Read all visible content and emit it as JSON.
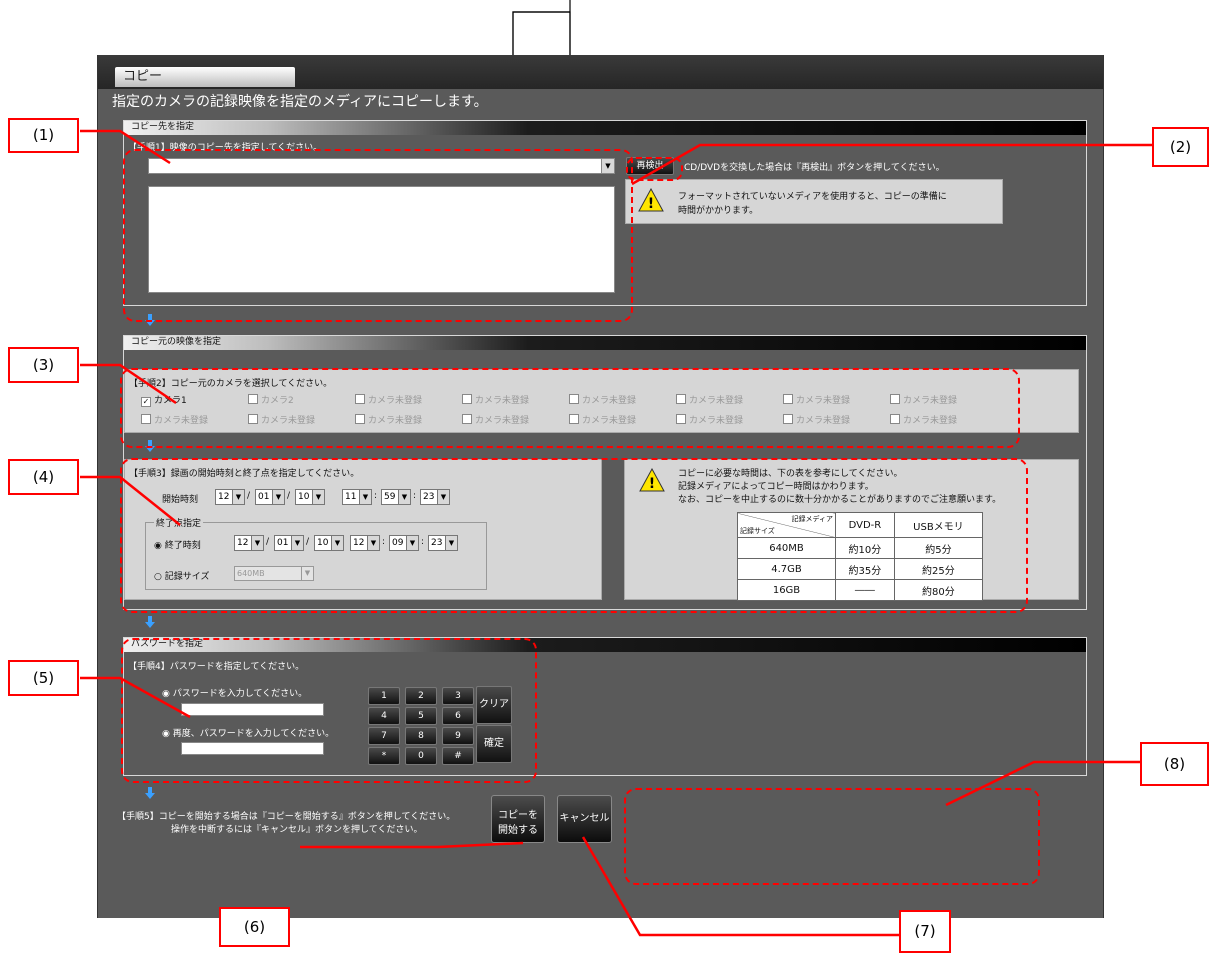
{
  "window": {
    "tab_title": "コピー",
    "description": "指定のカメラの記録映像を指定のメディアにコピーします。"
  },
  "sections": {
    "dest_header": "コピー先を指定",
    "source_header": "コピー元の映像を指定",
    "password_header": "パスワードを指定"
  },
  "step1": {
    "label": "【手順1】映像のコピー先を指定してください。",
    "rescan_button": "再検出",
    "rescan_note": "CD/DVDを交換した場合は『再検出』ボタンを押してください。",
    "warning_line1": "フォーマットされていないメディアを使用すると、コピーの準備に",
    "warning_line2": "時間がかかります。"
  },
  "step2": {
    "label": "【手順2】コピー元のカメラを選択してください。",
    "cameras_row1": [
      {
        "label": "カメラ1",
        "checked": true
      },
      {
        "label": "カメラ2",
        "checked": false
      },
      {
        "label": "カメラ未登録",
        "checked": false
      },
      {
        "label": "カメラ未登録",
        "checked": false
      },
      {
        "label": "カメラ未登録",
        "checked": false
      },
      {
        "label": "カメラ未登録",
        "checked": false
      },
      {
        "label": "カメラ未登録",
        "checked": false
      },
      {
        "label": "カメラ未登録",
        "checked": false
      }
    ],
    "cameras_row2": [
      {
        "label": "カメラ未登録",
        "checked": false
      },
      {
        "label": "カメラ未登録",
        "checked": false
      },
      {
        "label": "カメラ未登録",
        "checked": false
      },
      {
        "label": "カメラ未登録",
        "checked": false
      },
      {
        "label": "カメラ未登録",
        "checked": false
      },
      {
        "label": "カメラ未登録",
        "checked": false
      },
      {
        "label": "カメラ未登録",
        "checked": false
      },
      {
        "label": "カメラ未登録",
        "checked": false
      }
    ]
  },
  "step3": {
    "label": "【手順3】録画の開始時刻と終了点を指定してください。",
    "start_label": "開始時刻",
    "start": {
      "yy": "12",
      "mm": "01",
      "dd": "10",
      "hh": "11",
      "mi": "59",
      "ss": "23"
    },
    "end_group": "終了点指定",
    "end_time_label": "終了時刻",
    "end": {
      "yy": "12",
      "mm": "01",
      "dd": "10",
      "hh": "12",
      "mi": "09",
      "ss": "23"
    },
    "size_label": "記録サイズ",
    "size_value": "640MB",
    "sep_slash": "/",
    "sep_colon": ":"
  },
  "info": {
    "line1": "コピーに必要な時間は、下の表を参考にしてください。",
    "line2": "記録メディアによってコピー時間はかわります。",
    "line3": "なお、コピーを中止するのに数十分かかることがありますのでご注意願います。",
    "table_corner_top": "記録メディア",
    "table_corner_bottom": "記録サイズ",
    "columns": [
      "DVD-R",
      "USBメモリ"
    ],
    "rows": [
      {
        "size": "640MB",
        "dvd": "約10分",
        "usb": "約5分"
      },
      {
        "size": "4.7GB",
        "dvd": "約35分",
        "usb": "約25分"
      },
      {
        "size": "16GB",
        "dvd": "――",
        "usb": "約80分"
      }
    ]
  },
  "step4": {
    "label": "【手順4】パスワードを指定してください。",
    "prompt1": "パスワードを入力してください。",
    "prompt2": "再度、パスワードを入力してください。",
    "keys": [
      "1",
      "2",
      "3",
      "4",
      "5",
      "6",
      "7",
      "8",
      "9",
      "*",
      "0",
      "#"
    ],
    "clear": "クリア",
    "confirm": "確定"
  },
  "step5": {
    "line1": "【手順5】コピーを開始する場合は『コピーを開始する』ボタンを押してください。",
    "line2": "操作を中断するには『キャンセル』ボタンを押してください。",
    "start_line1": "コピーを",
    "start_line2": "開始する",
    "cancel": "キャンセル"
  },
  "callouts": [
    "(1)",
    "(2)",
    "(3)",
    "(4)",
    "(5)",
    "(6)",
    "(7)",
    "(8)"
  ],
  "colors": {
    "annotation": "#ff0000",
    "window_bg": "#5a5a5a",
    "panel_bg": "#d6d6d6"
  }
}
